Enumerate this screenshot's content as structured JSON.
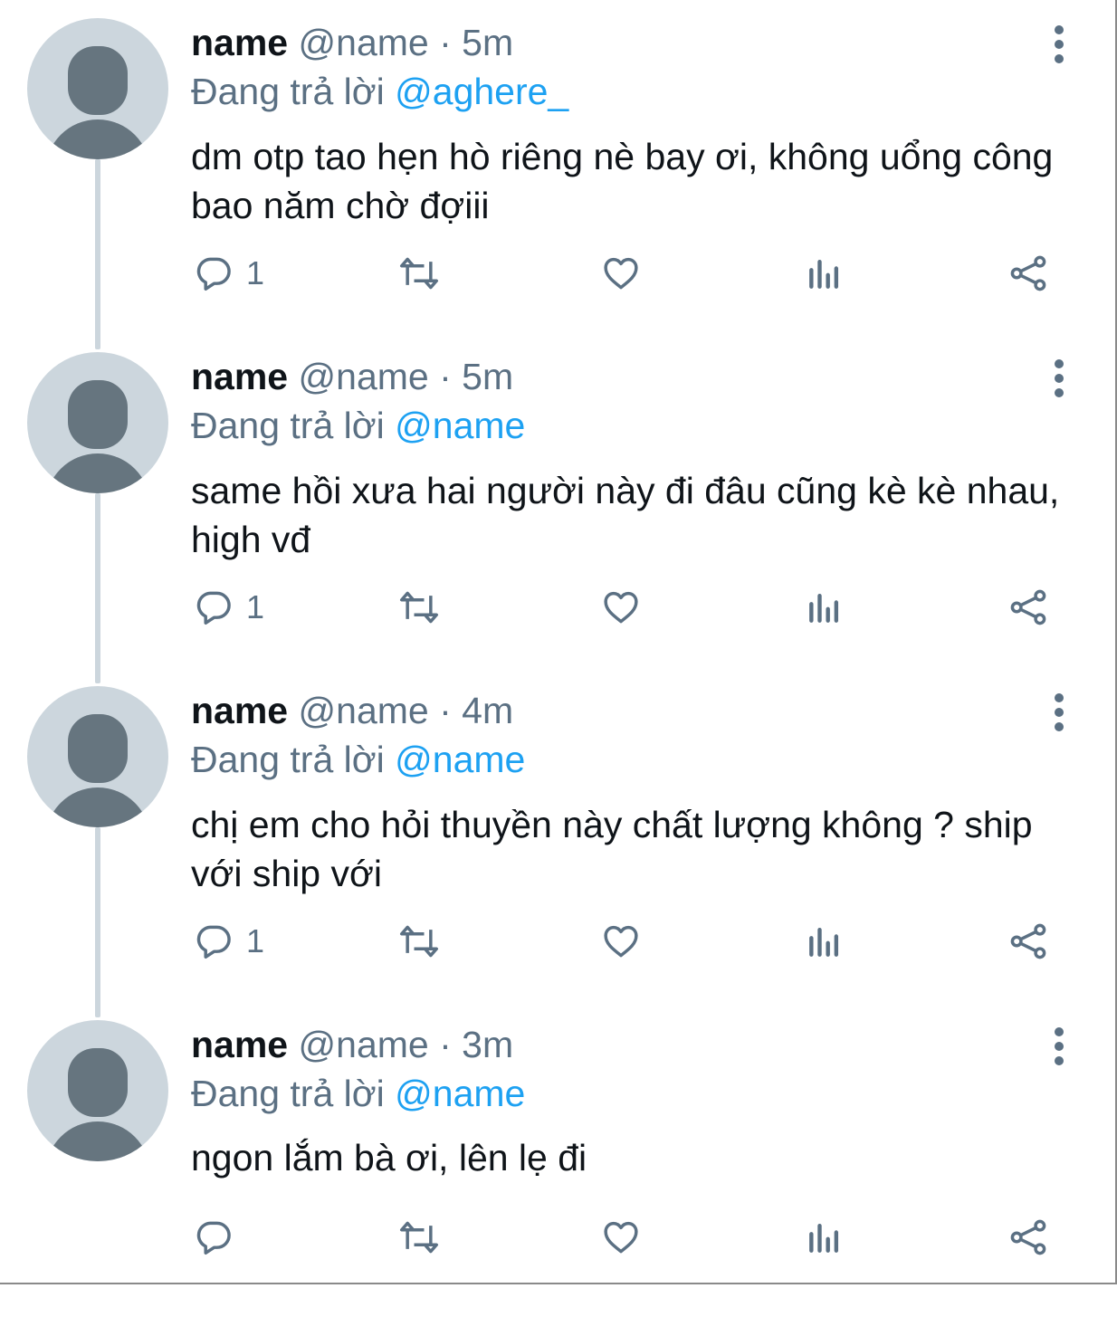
{
  "colors": {
    "text": "#0f1419",
    "muted": "#5b7083",
    "accent": "#1da1f2",
    "avatar_bg": "#ccd6dd",
    "avatar_fg": "#66757f"
  },
  "icons": [
    "avatar-icon",
    "more-icon",
    "reply-icon",
    "retweet-icon",
    "like-icon",
    "analytics-icon",
    "share-icon"
  ],
  "tweets": [
    {
      "name": "name",
      "handle": "@name",
      "dot": " · ",
      "time": "5m",
      "reply_prefix": "Đang trả lời ",
      "reply_to": "@aghere_",
      "text": "dm otp tao hẹn hò riêng nè bay ơi, không uổng công bao năm chờ đợiii",
      "reply_count": "1"
    },
    {
      "name": "name",
      "handle": "@name",
      "dot": " · ",
      "time": "5m",
      "reply_prefix": "Đang trả lời ",
      "reply_to": "@name",
      "text": "same hồi xưa hai người này đi đâu cũng kè kè nhau, high vđ",
      "reply_count": "1"
    },
    {
      "name": "name",
      "handle": "@name",
      "dot": " · ",
      "time": "4m",
      "reply_prefix": "Đang trả lời ",
      "reply_to": "@name",
      "text": "chị em cho hỏi thuyền này chất lượng không ? ship với ship với",
      "reply_count": "1"
    },
    {
      "name": "name",
      "handle": "@name",
      "dot": " · ",
      "time": "3m",
      "reply_prefix": "Đang trả lời ",
      "reply_to": "@name",
      "text": "ngon lắm bà ơi, lên lẹ đi",
      "reply_count": ""
    }
  ]
}
